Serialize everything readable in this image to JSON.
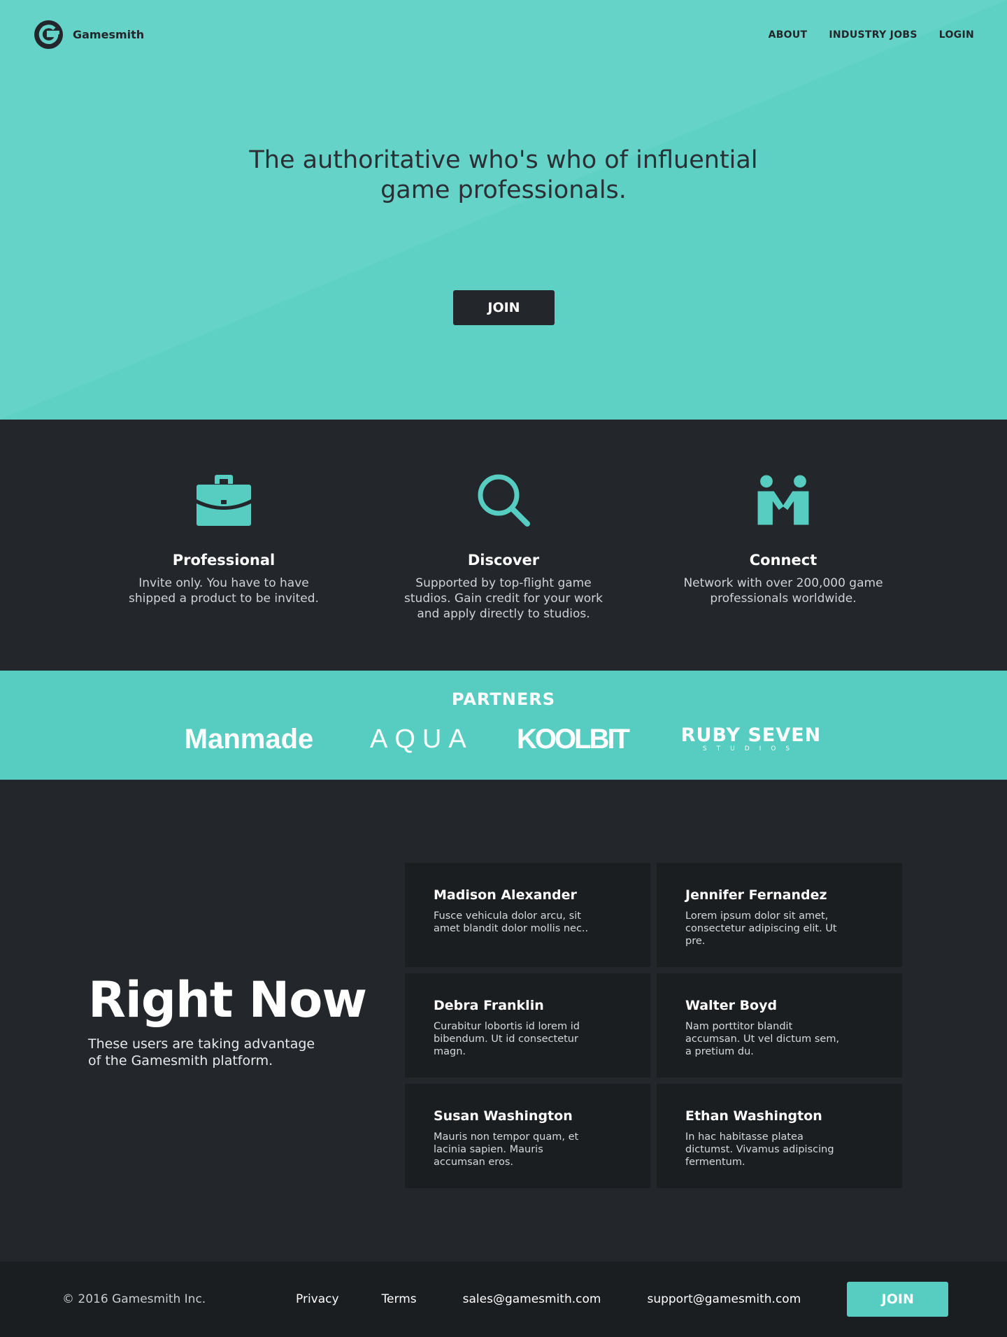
{
  "header": {
    "brand_name": "Gamesmith",
    "nav": {
      "about": "ABOUT",
      "industry_jobs": "INDUSTRY JOBS",
      "login": "LOGIN"
    }
  },
  "hero": {
    "title": "The authoritative who's who of influential game professionals.",
    "join_label": "JOIN"
  },
  "features": [
    {
      "icon": "briefcase-icon",
      "title": "Professional",
      "text": "Invite only. You have to have shipped a product to be invited."
    },
    {
      "icon": "magnifier-icon",
      "title": "Discover",
      "text": "Supported by top-flight game studios. Gain credit for your work and apply directly to studios."
    },
    {
      "icon": "handshake-icon",
      "title": "Connect",
      "text": "Network with over 200,000 game professionals worldwide."
    }
  ],
  "partners": {
    "title": "PARTNERS",
    "logos": {
      "manmade": "Manmade",
      "aqua": "AQUA",
      "koolbit": "KOOLBIT",
      "ruby_main": "RUBY SEVEN",
      "ruby_sub": "STUDIOS"
    }
  },
  "right_now": {
    "title": "Right Now",
    "subtitle": "These users are taking advantage of the Gamesmith platform.",
    "cards": [
      {
        "name": "Madison Alexander",
        "text": "Fusce vehicula dolor arcu, sit amet blandit dolor mollis nec.."
      },
      {
        "name": "Jennifer Fernandez",
        "text": "Lorem ipsum dolor sit amet, consectetur adipiscing elit. Ut pre."
      },
      {
        "name": "Debra Franklin",
        "text": "Curabitur lobortis id lorem id bibendum. Ut id consectetur magn."
      },
      {
        "name": "Walter Boyd",
        "text": "Nam porttitor blandit accumsan. Ut vel dictum sem, a pretium du."
      },
      {
        "name": "Susan Washington",
        "text": "Mauris non tempor quam, et lacinia sapien. Mauris accumsan eros."
      },
      {
        "name": "Ethan Washington",
        "text": "In hac habitasse platea dictumst. Vivamus adipiscing fermentum."
      }
    ]
  },
  "footer": {
    "copyright": "© 2016 Gamesmith Inc.",
    "privacy": "Privacy",
    "terms": "Terms",
    "sales_email": "sales@gamesmith.com",
    "support_email": "support@gamesmith.com",
    "join_label": "JOIN"
  },
  "colors": {
    "teal": "#57cdc1",
    "teal_light": "#66d3c8",
    "dark": "#23272b",
    "darker": "#1b1e21"
  }
}
